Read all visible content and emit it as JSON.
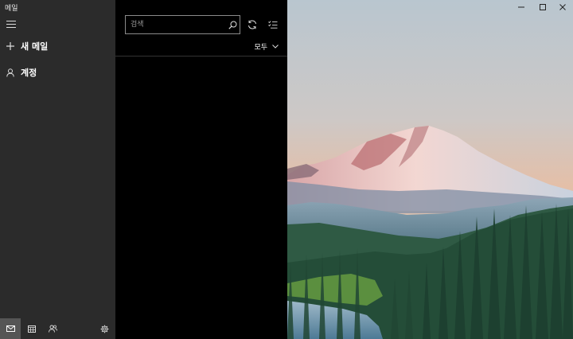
{
  "app": {
    "title": "메일"
  },
  "sidebar": {
    "new_mail_label": "새 메일",
    "accounts_label": "계정"
  },
  "list": {
    "search_placeholder": "검색",
    "filter_label": "모두"
  },
  "icons": {
    "menu": "hamburger-icon",
    "new_mail": "plus-icon",
    "accounts": "person-icon",
    "search": "search-icon",
    "sync": "sync-icon",
    "select": "select-mode-icon",
    "filter": "chevron-down-icon",
    "mail": "mail-icon",
    "calendar": "calendar-icon",
    "people": "people-icon",
    "settings": "gear-icon",
    "minimize": "minimize-icon",
    "maximize": "maximize-icon",
    "close": "close-icon"
  },
  "colors": {
    "sidebar_bg": "#2b2b2b",
    "list_bg": "#000000",
    "active_tab_bg": "#555555"
  }
}
